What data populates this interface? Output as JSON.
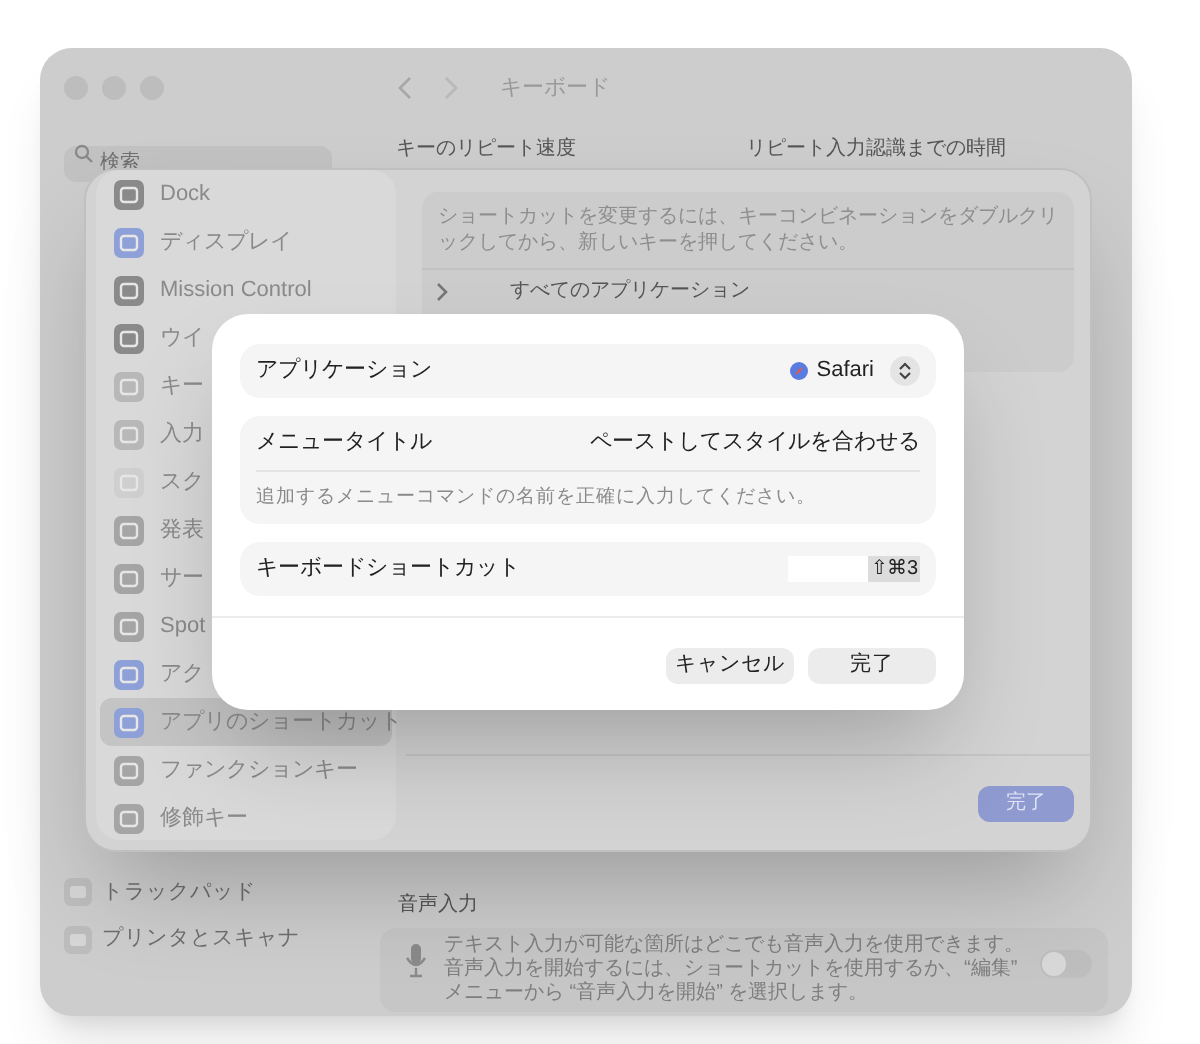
{
  "background_window": {
    "title": "キーボード",
    "search": {
      "placeholder": "検索"
    },
    "sidebar_items": [
      {
        "label": "トラックパッド"
      },
      {
        "label": "プリンタとスキャナ"
      }
    ],
    "repeat_columns": [
      "キーのリピート速度",
      "リピート入力認識までの時間"
    ],
    "dictation": {
      "heading": "音声入力",
      "description": "テキスト入力が可能な箇所はどこでも音声入力を使用できます。音声入力を開始するには、ショートカットを使用するか、“編集” メニューから “音声入力を開始” を選択します。",
      "on": false
    }
  },
  "sheet": {
    "sidebar": {
      "items": [
        {
          "label": "Dock",
          "selected": false
        },
        {
          "label": "ディスプレイ",
          "selected": false
        },
        {
          "label": "Mission Control",
          "selected": false
        },
        {
          "label": "ウイ",
          "selected": false
        },
        {
          "label": "キー",
          "selected": false
        },
        {
          "label": "入力",
          "selected": false
        },
        {
          "label": "スク",
          "selected": false
        },
        {
          "label": "発表",
          "selected": false
        },
        {
          "label": "サー",
          "selected": false
        },
        {
          "label": "Spot",
          "selected": false
        },
        {
          "label": "アク",
          "selected": false
        },
        {
          "label": "アプリのショートカット",
          "selected": true
        },
        {
          "label": "ファンクションキー",
          "selected": false
        },
        {
          "label": "修飾キー",
          "selected": false
        }
      ]
    },
    "hint": "ショートカットを変更するには、キーコンビネーションをダブルクリックしてから、新しいキーを押してください。",
    "group": {
      "label": "すべてのアプリケーション",
      "expanded": false
    },
    "done_button": "完了"
  },
  "dialog": {
    "fields": [
      {
        "kind": "popup",
        "label": "アプリケーション",
        "value": "Safari"
      },
      {
        "kind": "text",
        "label": "メニュータイトル",
        "value": "ペーストしてスタイルを合わせる",
        "hint": "追加するメニューコマンドの名前を正確に入力してください。"
      },
      {
        "kind": "shortcut",
        "label": "キーボードショートカット",
        "value": "⇧⌘3"
      }
    ],
    "buttons": [
      "キャンセル",
      "完了"
    ]
  }
}
